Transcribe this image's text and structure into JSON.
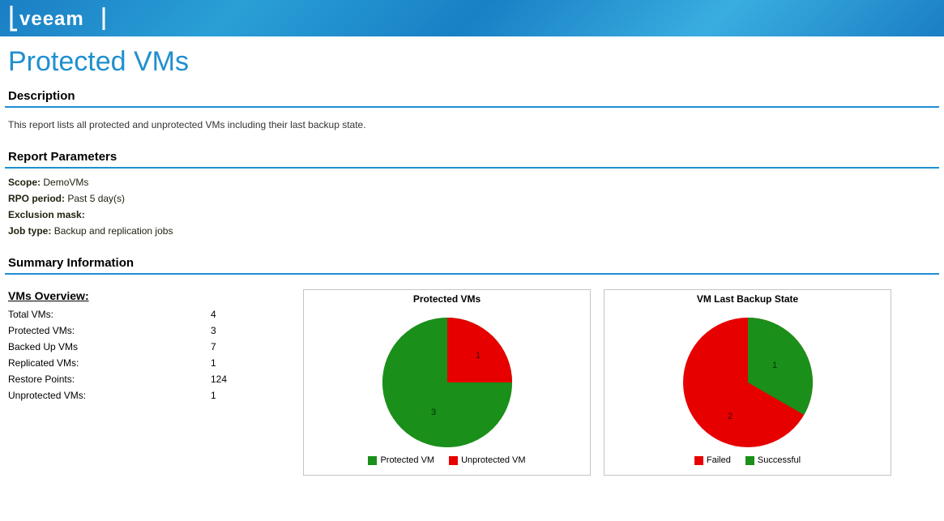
{
  "logo_text": "veeam",
  "title": "Protected VMs",
  "sections": {
    "description": {
      "heading": "Description",
      "text": "This report lists all protected and unprotected VMs including their last backup state."
    },
    "parameters": {
      "heading": "Report Parameters",
      "scope_label": "Scope:",
      "scope_value": "DemoVMs",
      "rpo_label": "RPO period:",
      "rpo_value": "Past 5 day(s)",
      "excl_label": "Exclusion mask:",
      "excl_value": "",
      "jobtype_label": "Job type:",
      "jobtype_value": "Backup and replication jobs"
    },
    "summary": {
      "heading": "Summary Information"
    }
  },
  "overview": {
    "title": "VMs Overview:",
    "rows": [
      {
        "label": "Total VMs:",
        "value": "4"
      },
      {
        "label": "Protected VMs:",
        "value": "3"
      },
      {
        "label": "Backed Up VMs",
        "value": "7"
      },
      {
        "label": "Replicated VMs:",
        "value": "1"
      },
      {
        "label": "Restore Points:",
        "value": "124"
      },
      {
        "label": "Unprotected VMs:",
        "value": "1"
      }
    ]
  },
  "charts": {
    "protected": {
      "title": "Protected VMs",
      "legend1": "Protected VM",
      "legend2": "Unprotected VM"
    },
    "backup": {
      "title": "VM Last Backup State",
      "legend1": "Failed",
      "legend2": "Successful"
    }
  },
  "colors": {
    "green": "#1a8f1a",
    "red": "#e60000"
  },
  "chart_data": [
    {
      "type": "pie",
      "title": "Protected VMs",
      "series": [
        {
          "name": "Protected VM",
          "value": 3,
          "color": "#1a8f1a"
        },
        {
          "name": "Unprotected VM",
          "value": 1,
          "color": "#e60000"
        }
      ]
    },
    {
      "type": "pie",
      "title": "VM Last Backup State",
      "series": [
        {
          "name": "Failed",
          "value": 2,
          "color": "#e60000"
        },
        {
          "name": "Successful",
          "value": 1,
          "color": "#1a8f1a"
        }
      ]
    }
  ]
}
